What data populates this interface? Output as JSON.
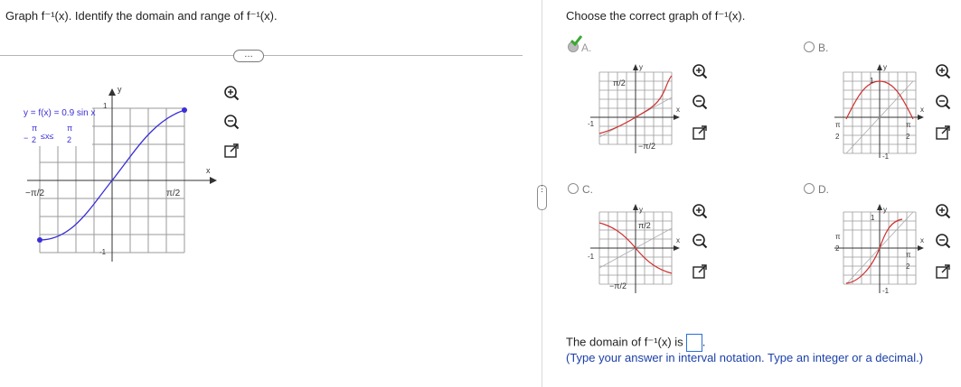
{
  "left": {
    "prompt": "Graph f⁻¹(x). Identify the domain and range of f⁻¹(x).",
    "more_label": "…",
    "graph": {
      "function_label": "y = f(x) = 0.9 sin x",
      "interval_label_lhs": "−",
      "interval_pi": "π",
      "interval_two": "2",
      "interval_ineq": "≤x≤",
      "tick_x_neg": "−π/2",
      "tick_x_pos": "π/2",
      "tick_y_pos": "1",
      "tick_y_neg": "-1",
      "axis_x": "x",
      "axis_y": "y"
    }
  },
  "right": {
    "prompt": "Choose the correct graph of f⁻¹(x).",
    "options": [
      {
        "letter": "A.",
        "selected": true,
        "tick_top": "π/2",
        "tick_bottom": "−π/2",
        "tick_left": "-1"
      },
      {
        "letter": "B.",
        "selected": false,
        "tick_top": "1",
        "tick_bottom": "-1",
        "tick_left_pi": "π",
        "tick_right_pi": "π",
        "tick_two": "2"
      },
      {
        "letter": "C.",
        "selected": false,
        "tick_top": "π/2",
        "tick_bottom": "−π/2",
        "tick_left": "-1"
      },
      {
        "letter": "D.",
        "selected": false,
        "tick_top": "1",
        "tick_bottom": "-1",
        "tick_left_pi": "π",
        "tick_right_pi": "π",
        "tick_two": "2"
      }
    ],
    "axis_x": "x",
    "axis_y": "y",
    "domain_prefix": "The domain of f⁻¹(x) is",
    "domain_value": "",
    "hint": "(Type your answer in interval notation. Type an integer or a decimal.)"
  },
  "colors": {
    "curve_blue": "#3a2fd6",
    "curve_red": "#d03030",
    "grid": "#9a9a9a",
    "check_green": "#3aa832",
    "accent_blue": "#2a6fd6"
  },
  "icons": [
    "zoom-in-icon",
    "zoom-out-icon",
    "expand-icon",
    "checkmark-icon"
  ]
}
